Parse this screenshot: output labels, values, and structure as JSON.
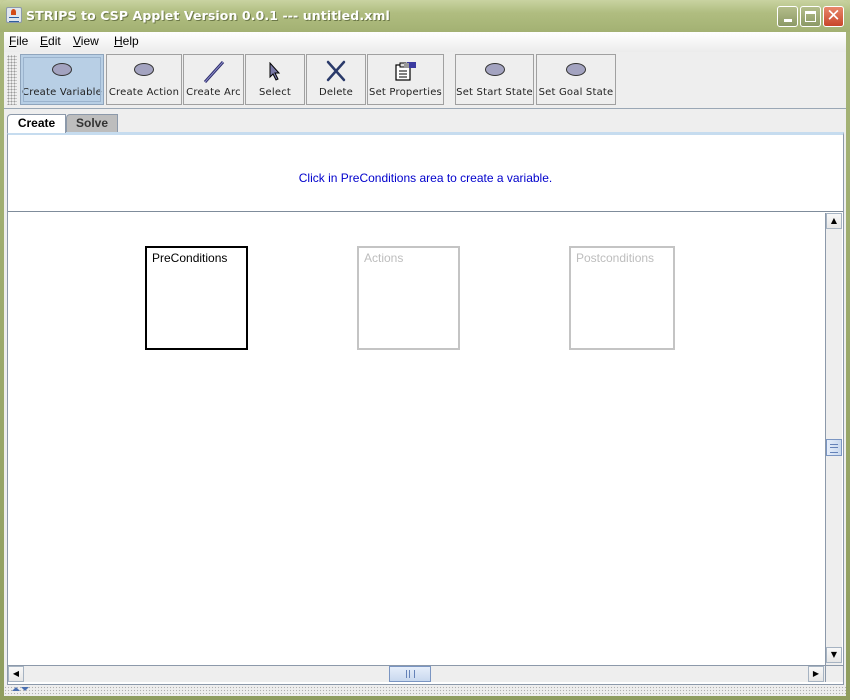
{
  "window": {
    "title": "STRIPS to CSP Applet Version 0.0.1 --- untitled.xml",
    "controls": {
      "minimize": "_",
      "maximize": "□",
      "close": "✕"
    }
  },
  "menubar": {
    "items": [
      {
        "label": "File",
        "mnemonic": "F"
      },
      {
        "label": "Edit",
        "mnemonic": "E"
      },
      {
        "label": "View",
        "mnemonic": "V"
      },
      {
        "label": "Help",
        "mnemonic": "H"
      }
    ]
  },
  "toolbar": {
    "buttons": [
      {
        "label": "Create Variable",
        "icon": "oval-icon",
        "selected": true
      },
      {
        "label": "Create Action",
        "icon": "oval-icon",
        "selected": false
      },
      {
        "label": "Create Arc",
        "icon": "line-icon",
        "selected": false
      },
      {
        "label": "Select",
        "icon": "arrow-cursor-icon",
        "selected": false
      },
      {
        "label": "Delete",
        "icon": "x-icon",
        "selected": false
      },
      {
        "label": "Set Properties",
        "icon": "properties-icon",
        "selected": false
      },
      {
        "label": "Set Start State",
        "icon": "oval-icon",
        "selected": false
      },
      {
        "label": "Set Goal State",
        "icon": "oval-icon",
        "selected": false
      }
    ]
  },
  "tabs": [
    {
      "label": "Create",
      "active": true
    },
    {
      "label": "Solve",
      "active": false
    }
  ],
  "message": "Click in PreConditions area to create a variable.",
  "canvas": {
    "regions": [
      {
        "label": "PreConditions",
        "active": true
      },
      {
        "label": "Actions",
        "active": false
      },
      {
        "label": "Postconditions",
        "active": false
      }
    ]
  },
  "colors": {
    "message_text": "#0000cc",
    "selected_tool": "#b8cfe5",
    "active_region_border": "#000000",
    "inactive_region_border": "#c4c4c4"
  }
}
